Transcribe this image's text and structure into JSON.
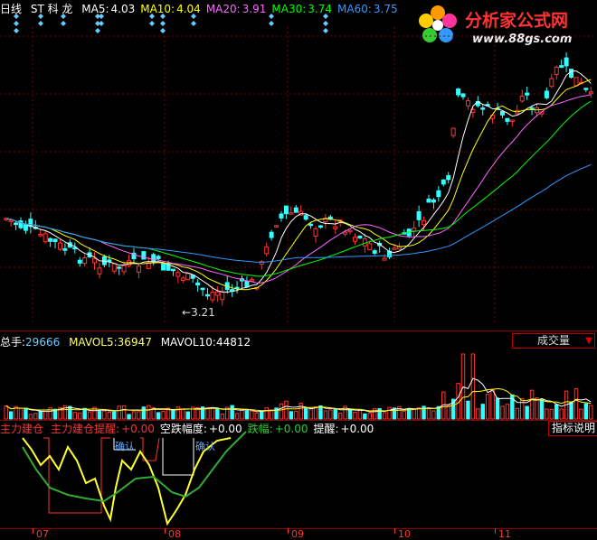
{
  "main": {
    "period": "日线",
    "stock": "ST 科 龙",
    "ma": [
      {
        "label": "MA5:",
        "value": "4.03",
        "color": "#ffffff"
      },
      {
        "label": "MA10:",
        "value": "4.04",
        "color": "#ffff00"
      },
      {
        "label": "MA20:",
        "value": "3.91",
        "color": "#ff66ff"
      },
      {
        "label": "MA30:",
        "value": "3.74",
        "color": "#00ff00"
      },
      {
        "label": "MA60:",
        "value": "3.75",
        "color": "#3399ff"
      }
    ],
    "low_marker": "3.21"
  },
  "volume": {
    "total_label": "总手:",
    "total_value": "29666",
    "mavol5_label": "MAVOL5:",
    "mavol5_value": "36947",
    "mavol10_label": "MAVOL10:",
    "mavol10_value": "44812",
    "dropdown_label": "成交量",
    "dropdown_arrow": "▼"
  },
  "indicator": {
    "items": [
      {
        "label": "主力建仓",
        "value": "",
        "color": "#ff3333"
      },
      {
        "label": "主力建仓提醒:",
        "value": "+0.00",
        "color": "#ff3333"
      },
      {
        "label": "空跌幅度:",
        "value": "+0.00",
        "color": "#ffffff"
      },
      {
        "label": "跌幅:",
        "value": "+0.00",
        "color": "#33cc33"
      },
      {
        "label": "提醒:",
        "value": "+0.00",
        "color": "#ffffff"
      }
    ],
    "help_label": "指标说明",
    "confirm1": "确认",
    "confirm2": "确认"
  },
  "xaxis": {
    "months": [
      "07",
      "08",
      "09",
      "10",
      "11"
    ]
  },
  "logo": {
    "cn": "分析家公式网",
    "url": "www.88gs.com"
  }
}
